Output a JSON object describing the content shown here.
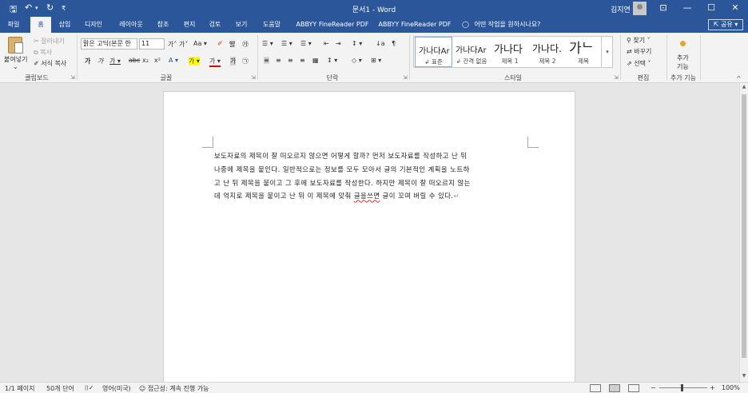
{
  "titlebar": {
    "save_glyph": "🖫",
    "undo_glyph": "↶",
    "undo_dropdown": "▾",
    "redo_glyph": "↻",
    "customize_glyph": "₹",
    "title": "문서1  -  Word",
    "user": "김지연",
    "ribbon_display_glyph": "⊡",
    "minimize_glyph": "—",
    "maximize_glyph": "☐",
    "close_glyph": "✕"
  },
  "tabs": [
    "파일",
    "홈",
    "삽입",
    "디자인",
    "레이아웃",
    "참조",
    "편지",
    "검토",
    "보기",
    "도움말",
    "ABBYY FineReader PDF 15",
    "ABBYY FineReader PDF"
  ],
  "active_tab": "홈",
  "tell_me": {
    "icon": "lightbulb-icon",
    "text": "어떤 작업을 원하시나요?"
  },
  "share": "⇱ 공유 ▾",
  "clipboard": {
    "paste": "붙여넣기",
    "paste_arrow": "⌄",
    "cut": "잘라내기",
    "copy": "복사",
    "format_painter": "서식 복사",
    "group_label": "클립보드"
  },
  "font": {
    "font_name": "맑은 고딕(본문 한",
    "font_size": "11",
    "row1_icons": [
      "가˄",
      "가˅",
      "Aa ▾",
      "✐",
      "뻃",
      "㉮"
    ],
    "row2_icons": [
      "가",
      "가",
      "가 ▾",
      "abc",
      "x₂",
      "x²",
      "A ▾",
      "가 ▾",
      "가 ▾",
      "가",
      "㉠"
    ],
    "group_label": "글꼴"
  },
  "paragraph": {
    "row1_icons": [
      "☰ ▾",
      "☰ ▾",
      "☰ ▾",
      "⇤",
      "⇥",
      "↕ ▾",
      "↓a",
      "¶"
    ],
    "row2_icons": [
      "≡",
      "≡",
      "≡",
      "≡",
      "▦",
      "↕ ▾",
      "◇ ▾",
      "⊞ ▾"
    ],
    "group_label": "단락"
  },
  "styles": {
    "items": [
      {
        "sample": "가나다Ar",
        "name": "↲ 표준"
      },
      {
        "sample": "가나다Ar",
        "name": "↲ 간격 없음"
      },
      {
        "sample": "가나다",
        "name": "제목 1"
      },
      {
        "sample": "가나다.",
        "name": "제목 2"
      },
      {
        "sample": "가ᄂ",
        "name": "제목"
      }
    ],
    "more": "▾",
    "group_label": "스타일"
  },
  "editing": {
    "find": "찾기",
    "replace": "바꾸기",
    "select": "선택",
    "group_label": "편집"
  },
  "addins": {
    "button_line1": "추가",
    "button_line2": "기능",
    "group_label": "추가 기능"
  },
  "ribbon_collapse": "^",
  "document": {
    "lines": [
      "보도자료의 제목이 잘 떠오르지 않으면 어떻게 할까? 먼저 보도자료를 작성하고 난 뒤",
      "나중에 제목을 붙인다. 일반적으로는 정보를 모두 모아서 글의 기본적인 계획을 노트하",
      "고 난 뒤 제목을 붙이고 그 후에 보도자료를 작성한다. 하지만 제목이 잘 떠오르지 않는",
      "데 억지로 제목을 붙이고 난 뒤 이 제목에 맞춰 "
    ],
    "misspelled": "글을쓰면",
    "last_tail": " 글이 꼬여 버릴 수 있다.",
    "para_mark": "↵"
  },
  "scrollbar": {
    "up": "▲",
    "down": "▼"
  },
  "status": {
    "pages": "1/1 페이지",
    "words": "50개 단어",
    "proofing_icon": "proofing-icon",
    "proofing_glyph": "⌷✓",
    "language": "영어(미국)",
    "accessibility": "접근성: 계속 진행 가능",
    "accessibility_glyph": "☺",
    "zoom_minus": "−",
    "zoom_plus": "+",
    "zoom": "100%"
  }
}
